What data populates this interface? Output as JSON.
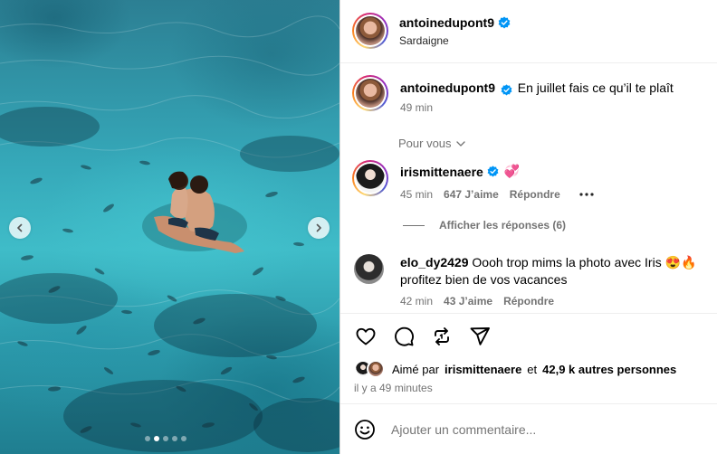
{
  "post": {
    "author": "antoinedupont9",
    "location": "Sardaigne",
    "caption": "En juillet fais ce qu’il te plaît",
    "caption_time": "49 min",
    "carousel": {
      "total_slides": 5,
      "current_slide": 2
    }
  },
  "comments_filter": {
    "label": "Pour vous"
  },
  "comments": [
    {
      "username": "irismittenaere",
      "verified": true,
      "text": "💞",
      "time": "45 min",
      "likes": "647 J’aime",
      "reply_label": "Répondre",
      "view_replies": "Afficher les réponses (6)"
    },
    {
      "username": "elo_dy2429",
      "verified": false,
      "text": "Oooh trop mims la photo avec Iris 😍🔥 profitez bien de vos vacances",
      "time": "42 min",
      "likes": "43 J’aime",
      "reply_label": "Répondre"
    }
  ],
  "likes_summary": {
    "prefix": "Aimé par",
    "user": "irismittenaere",
    "middle": "et",
    "others": "42,9 k autres personnes"
  },
  "posted_ago": "il y a 49 minutes",
  "comment_input": {
    "placeholder": "Ajouter un commentaire..."
  },
  "icons": {
    "verified": "verified-badge-icon",
    "like": "heart-icon",
    "comment": "comment-icon",
    "share": "repost-icon",
    "send": "send-icon",
    "emoji": "emoji-icon",
    "more": "more-icon"
  },
  "colors": {
    "verified": "#0095f6",
    "text_secondary": "#737373",
    "divider": "#efefef"
  }
}
